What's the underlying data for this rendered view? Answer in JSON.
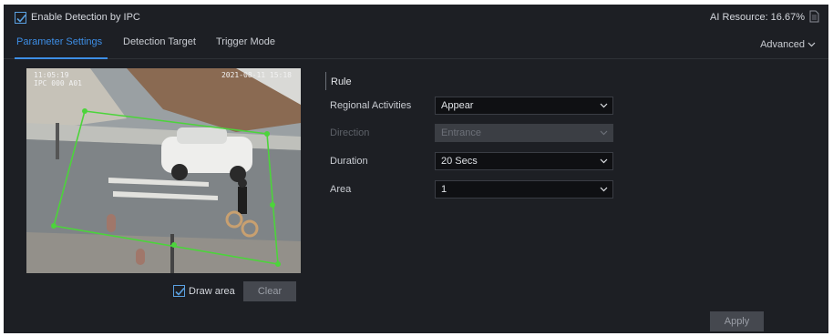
{
  "header": {
    "enable_detection_label": "Enable Detection by IPC",
    "enable_detection_checked": true,
    "ai_resource": "AI Resource: 16.67%",
    "ai_resource_icon": "document-icon"
  },
  "tabs": [
    {
      "label": "Parameter Settings",
      "active": true
    },
    {
      "label": "Detection Target",
      "active": false
    },
    {
      "label": "Trigger Mode",
      "active": false
    }
  ],
  "advanced_label": "Advanced",
  "video": {
    "osd_time": "2021-08-11 15:18",
    "osd_left_line1": "11:05:19",
    "osd_left_line2": "IPC 000 A01",
    "region_color": "#4cd43b"
  },
  "draw_area": {
    "label": "Draw area",
    "checked": true
  },
  "clear_label": "Clear",
  "rule": {
    "title": "Rule",
    "fields": [
      {
        "label": "Regional Activities",
        "value": "Appear",
        "disabled": false
      },
      {
        "label": "Direction",
        "value": "Entrance",
        "disabled": true
      },
      {
        "label": "Duration",
        "value": "20 Secs",
        "disabled": false
      },
      {
        "label": "Area",
        "value": "1",
        "disabled": false
      }
    ]
  },
  "apply_label": "Apply",
  "colors": {
    "accent": "#3d8ee6",
    "panel_bg": "#1d1f24",
    "button_bg": "#45484f"
  }
}
